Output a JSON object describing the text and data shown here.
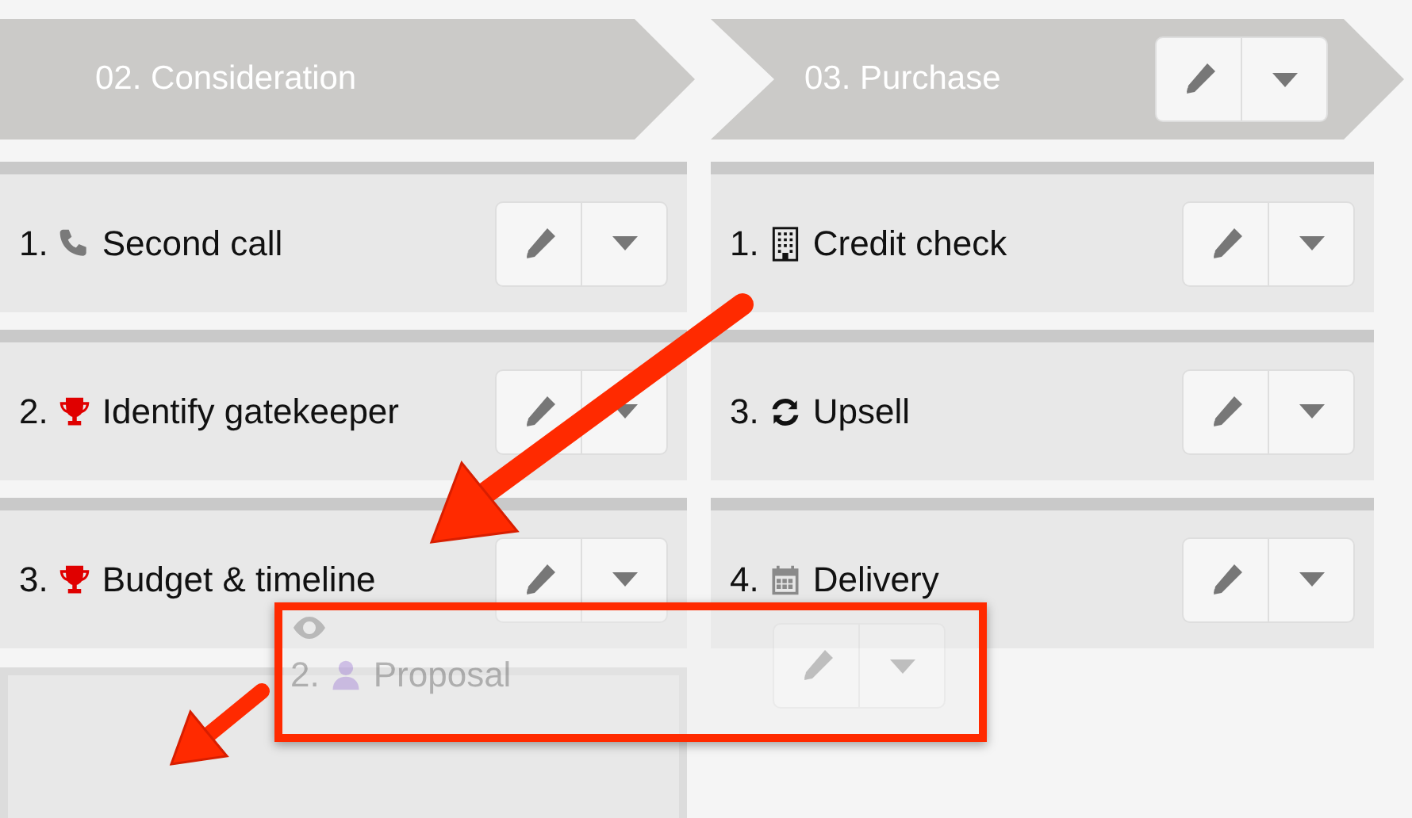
{
  "stages": [
    {
      "title": "02. Consideration",
      "actions": false,
      "tasks": [
        {
          "number": "1.",
          "kind": "phone",
          "label": "Second call"
        },
        {
          "number": "2.",
          "kind": "trophy",
          "label": "Identify gatekeeper"
        },
        {
          "number": "3.",
          "kind": "trophy",
          "label": "Budget & timeline"
        }
      ],
      "drop_placeholder": true
    },
    {
      "title": "03. Purchase",
      "actions": true,
      "tasks": [
        {
          "number": "1.",
          "kind": "building",
          "label": "Credit check"
        },
        {
          "number": "3.",
          "kind": "refresh",
          "label": "Upsell"
        },
        {
          "number": "4.",
          "kind": "calendar",
          "label": "Delivery"
        }
      ],
      "drop_placeholder": false
    }
  ],
  "dragged_task": {
    "number": "2.",
    "kind": "user",
    "label": "Proposal"
  }
}
